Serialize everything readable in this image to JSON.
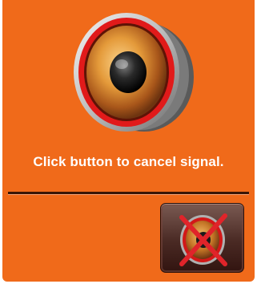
{
  "dialog": {
    "message": "Click button to cancel signal.",
    "speaker_icon": "speaker-icon",
    "cancel_icon": "cancel-speaker-icon"
  },
  "colors": {
    "background": "#f06a1a",
    "text": "#ffffff",
    "divider": "#3a1606",
    "button": "#4a2a24",
    "cross": "#e0242a"
  }
}
